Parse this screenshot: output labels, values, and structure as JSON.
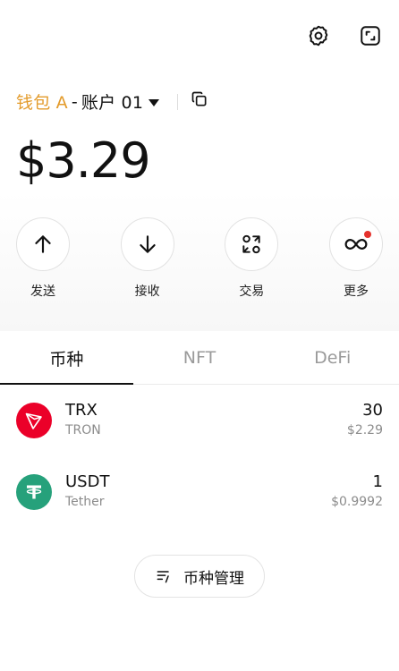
{
  "header": {
    "icons": [
      "settings-gear-icon",
      "expand-window-icon"
    ]
  },
  "wallet": {
    "name": "钱包 A",
    "separator": "-",
    "account": "账户 01"
  },
  "balance": "$3.29",
  "actions": [
    {
      "label": "发送",
      "icon": "arrow-up-icon"
    },
    {
      "label": "接收",
      "icon": "arrow-down-icon"
    },
    {
      "label": "交易",
      "icon": "swap-icon"
    },
    {
      "label": "更多",
      "icon": "infinity-more-icon"
    }
  ],
  "tabs": [
    {
      "label": "币种",
      "active": true
    },
    {
      "label": "NFT",
      "active": false
    },
    {
      "label": "DeFi",
      "active": false
    }
  ],
  "tokens": [
    {
      "symbol": "TRX",
      "name": "TRON",
      "amount": "30",
      "value": "$2.29",
      "color": "#eb0029"
    },
    {
      "symbol": "USDT",
      "name": "Tether",
      "amount": "1",
      "value": "$0.9992",
      "color": "#26a17b"
    }
  ],
  "manage_button": {
    "label": "币种管理"
  },
  "colors": {
    "wallet_accent": "#e39b2b",
    "notification_dot": "#e5322d"
  }
}
